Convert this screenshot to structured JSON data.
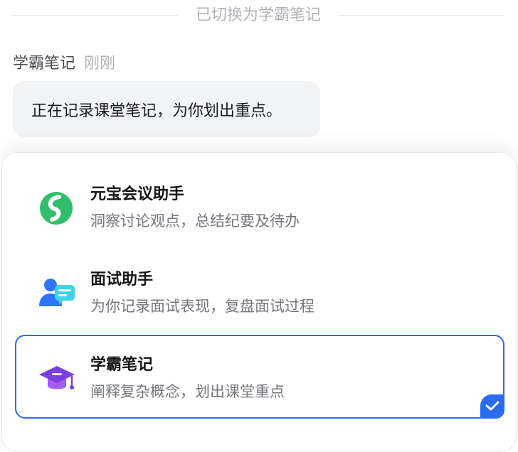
{
  "system_notice": {
    "text": "已切换为学霸笔记"
  },
  "message": {
    "sender": "学霸笔记",
    "time": "刚刚",
    "text": "正在记录课堂笔记，为你划出重点。"
  },
  "options": [
    {
      "title": "元宝会议助手",
      "description": "洞察讨论观点，总结纪要及待办",
      "icon": "yuanbao-logo-icon",
      "selected": false
    },
    {
      "title": "面试助手",
      "description": "为你记录面试表现，复盘面试过程",
      "icon": "interview-person-chat-icon",
      "selected": false
    },
    {
      "title": "学霸笔记",
      "description": "阐释复杂概念，划出课堂重点",
      "icon": "graduation-cap-icon",
      "selected": true
    }
  ],
  "colors": {
    "accent": "#2a6bf2",
    "green": "#2fbe6a",
    "purple": "#8a4be8"
  }
}
